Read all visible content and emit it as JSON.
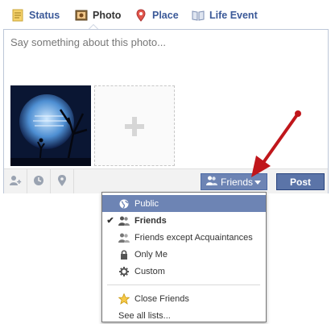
{
  "tabs": [
    {
      "label": "Status",
      "icon": "status-icon"
    },
    {
      "label": "Photo",
      "icon": "photo-icon"
    },
    {
      "label": "Place",
      "icon": "place-icon"
    },
    {
      "label": "Life Event",
      "icon": "life-event-icon"
    }
  ],
  "composer": {
    "placeholder": "Say something about this photo...",
    "tools": [
      "tag-people-icon",
      "clock-icon",
      "location-pin-icon"
    ]
  },
  "audience": {
    "selected_label": "Friends",
    "post_label": "Post"
  },
  "menu": {
    "items": [
      {
        "label": "Public",
        "icon": "globe-icon",
        "highlighted": true,
        "checked": false
      },
      {
        "label": "Friends",
        "icon": "friends-icon",
        "highlighted": false,
        "checked": true
      },
      {
        "label": "Friends except Acquaintances",
        "icon": "friends-except-icon",
        "highlighted": false,
        "checked": false
      },
      {
        "label": "Only Me",
        "icon": "lock-icon",
        "highlighted": false,
        "checked": false
      },
      {
        "label": "Custom",
        "icon": "gear-icon",
        "highlighted": false,
        "checked": false
      }
    ],
    "lists": [
      {
        "label": "Close Friends",
        "icon": "star-icon"
      }
    ],
    "see_all": "See all lists..."
  },
  "colors": {
    "brand": "#3b5998",
    "button": "#6d84b4",
    "highlight": "#6d84b4",
    "arrow": "#c0161b"
  }
}
